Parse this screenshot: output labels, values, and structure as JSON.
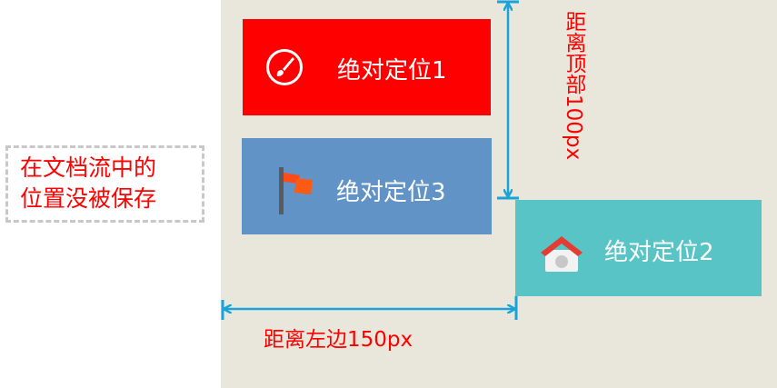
{
  "boxes": {
    "box1": {
      "label": "绝对定位1",
      "color": "#ff0000",
      "icon": "brush-icon"
    },
    "box3": {
      "label": "绝对定位3",
      "color": "#6193c6",
      "icon": "flag-icon"
    },
    "box2": {
      "label": "绝对定位2",
      "color": "#59c4c5",
      "icon": "home-icon"
    }
  },
  "note": {
    "line1": "在文档流中的",
    "line2": "位置没被保存"
  },
  "dimensions": {
    "top_label": "距离顶部100px",
    "left_label": "距离左边150px"
  },
  "colors": {
    "background": "#e9e6db",
    "arrow": "#1aa3d9",
    "annotation_text": "#ff0000"
  }
}
